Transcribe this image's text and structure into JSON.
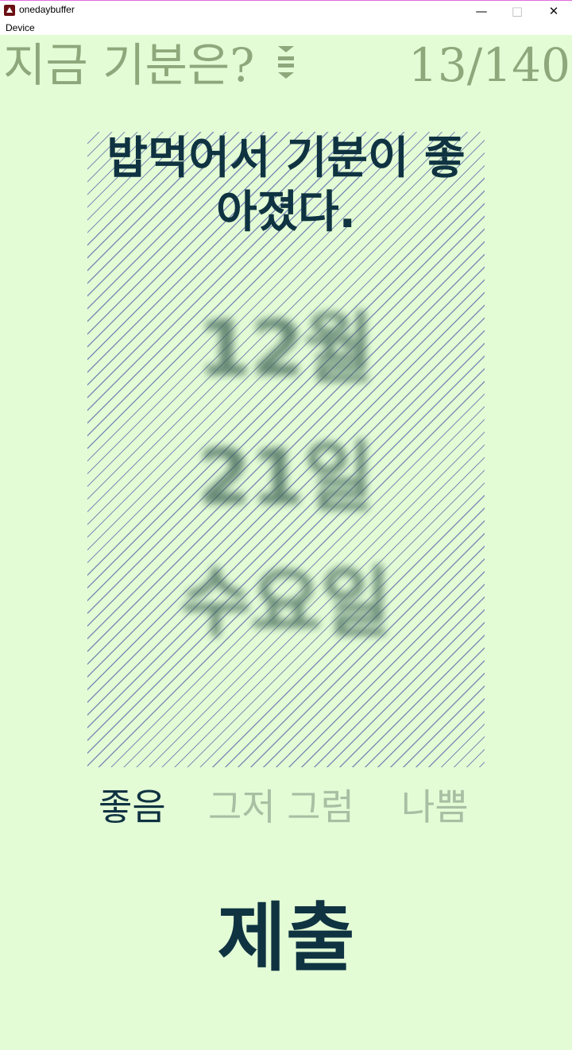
{
  "window": {
    "title": "onedaybuffer",
    "minimize_glyph": "—",
    "maximize_glyph": "□",
    "close_glyph": "✕",
    "icon": "app-logo-icon"
  },
  "menu": {
    "device_label": "Device"
  },
  "header": {
    "prompt": "지금 기분은?",
    "menu_icon": "sort-menu-icon",
    "counter": "13/140"
  },
  "card": {
    "text_line1": "밥먹어서 기분이 좋",
    "text_line2": "아졌다.",
    "date_month": "12월",
    "date_day": "21일",
    "date_weekday": "수요일"
  },
  "mood_options": {
    "good": "좋음",
    "so_so": "그저 그럼",
    "bad": "나쁨",
    "selected": "좋음"
  },
  "submit_label": "제출",
  "colors": {
    "background": "#e3fcd6",
    "primary_text": "#0f3341",
    "muted_text": "#8ea87c",
    "inactive_option": "#a7bfa2",
    "stripe": "#7d8fb5"
  }
}
